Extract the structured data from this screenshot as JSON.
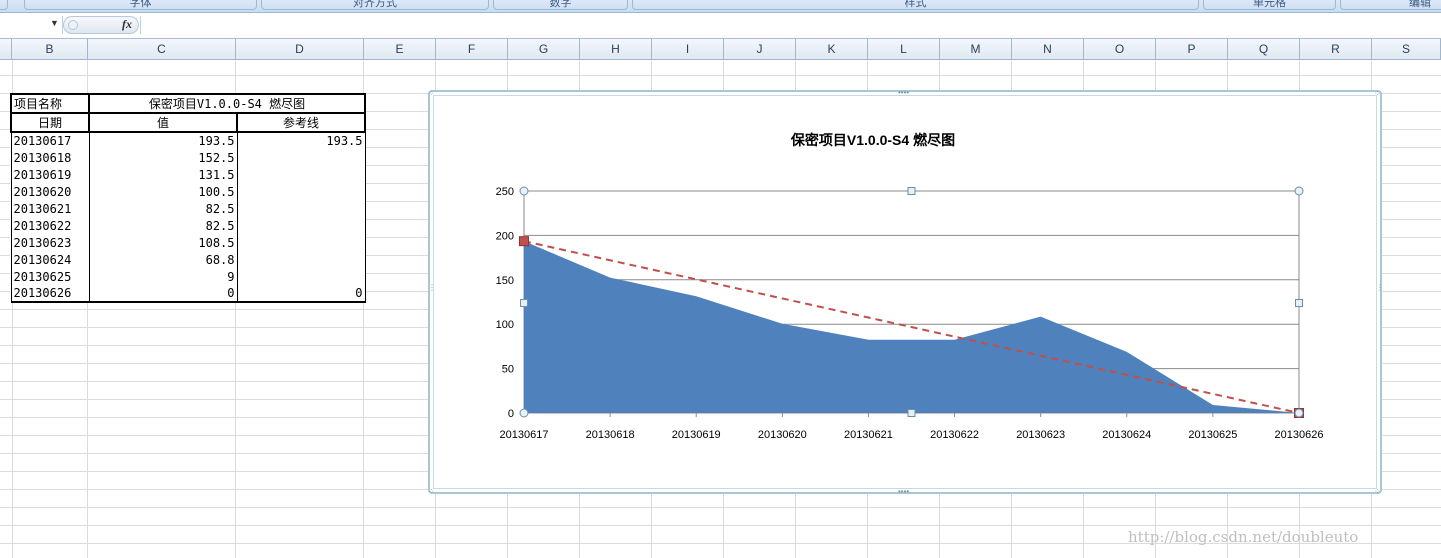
{
  "ribbon": {
    "groups": [
      "字体",
      "对齐方式",
      "数字",
      "样式",
      "单元格",
      "编辑"
    ]
  },
  "formula_bar": {
    "name_box": "",
    "fx_label": "fx",
    "formula": ""
  },
  "columns": [
    "B",
    "C",
    "D",
    "E",
    "F",
    "G",
    "H",
    "I",
    "J",
    "K",
    "L",
    "M",
    "N",
    "O",
    "P",
    "Q",
    "R",
    "S"
  ],
  "table": {
    "title_label": "项目名称",
    "title_value": "保密项目V1.0.0-S4 燃尽图",
    "headers": [
      "日期",
      "值",
      "参考线"
    ],
    "rows": [
      [
        "20130617",
        "193.5",
        "193.5"
      ],
      [
        "20130618",
        "152.5",
        ""
      ],
      [
        "20130619",
        "131.5",
        ""
      ],
      [
        "20130620",
        "100.5",
        ""
      ],
      [
        "20130621",
        "82.5",
        ""
      ],
      [
        "20130622",
        "82.5",
        ""
      ],
      [
        "20130623",
        "108.5",
        ""
      ],
      [
        "20130624",
        "68.8",
        ""
      ],
      [
        "20130625",
        "9",
        ""
      ],
      [
        "20130626",
        "0",
        "0"
      ]
    ]
  },
  "chart_data": {
    "type": "area",
    "title": "保密项目V1.0.0-S4 燃尽图",
    "categories": [
      "20130617",
      "20130618",
      "20130619",
      "20130620",
      "20130621",
      "20130622",
      "20130623",
      "20130624",
      "20130625",
      "20130626"
    ],
    "series": [
      {
        "values": [
          193.5,
          152.5,
          131.5,
          100.5,
          82.5,
          82.5,
          108.5,
          68.8,
          9,
          0
        ],
        "color": "#4f81bd",
        "style": "area"
      },
      {
        "values": [
          193.5,
          null,
          null,
          null,
          null,
          null,
          null,
          null,
          null,
          0
        ],
        "color": "#c0504d",
        "style": "dashed-line"
      }
    ],
    "ylim": [
      0,
      250
    ],
    "yticks": [
      0,
      50,
      100,
      150,
      200,
      250
    ],
    "grid": true,
    "legend": "none"
  },
  "watermark": "http://blog.csdn.net/doubleuto",
  "colors": {
    "area": "#4f81bd",
    "reference": "#c0504d",
    "grid": "#898989"
  }
}
